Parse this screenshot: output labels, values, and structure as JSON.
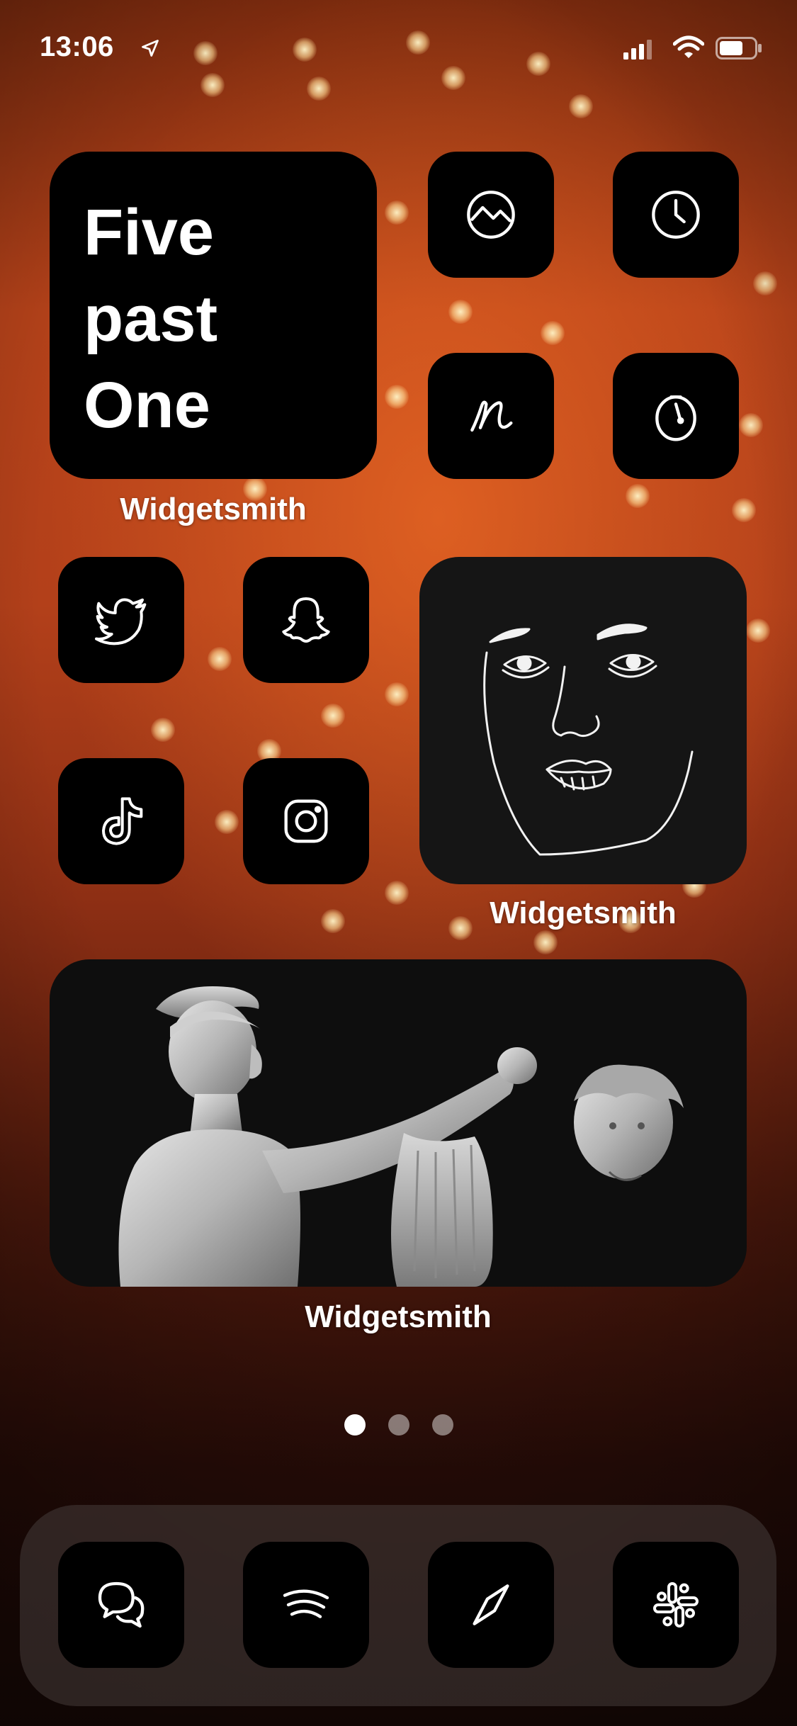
{
  "status_bar": {
    "time": "13:06",
    "icons": [
      "location-arrow-icon",
      "cellular-signal-icon",
      "wifi-icon",
      "battery-icon"
    ]
  },
  "page": {
    "text_widget": {
      "lines": [
        "Five",
        "past",
        "One"
      ],
      "label": "Widgetsmith"
    },
    "top_apps": [
      {
        "name": "stocks-app",
        "icon": "chart-circle-icon"
      },
      {
        "name": "clock-app",
        "icon": "clock-icon"
      },
      {
        "name": "notes-app",
        "icon": "script-n-icon"
      },
      {
        "name": "timer-app",
        "icon": "stopwatch-icon"
      }
    ],
    "social_apps": [
      {
        "name": "twitter-app",
        "icon": "twitter-bird-icon"
      },
      {
        "name": "snapchat-app",
        "icon": "ghost-icon"
      },
      {
        "name": "tiktok-app",
        "icon": "tiktok-note-icon"
      },
      {
        "name": "instagram-app",
        "icon": "camera-icon"
      }
    ],
    "face_widget": {
      "label": "Widgetsmith",
      "image": "line-drawing-face"
    },
    "statue_widget": {
      "label": "Widgetsmith",
      "image": "perseus-statue-photo"
    },
    "page_indicator": {
      "count": 3,
      "active_index": 0
    }
  },
  "dock": {
    "apps": [
      {
        "name": "messages-app",
        "icon": "chat-bubbles-icon"
      },
      {
        "name": "spotify-app",
        "icon": "spotify-waves-icon"
      },
      {
        "name": "safari-app",
        "icon": "compass-needle-icon"
      },
      {
        "name": "slack-app",
        "icon": "slack-hash-icon"
      }
    ]
  },
  "colors": {
    "tile_background": "#000000",
    "wallpaper_accent": "#b8431a"
  }
}
